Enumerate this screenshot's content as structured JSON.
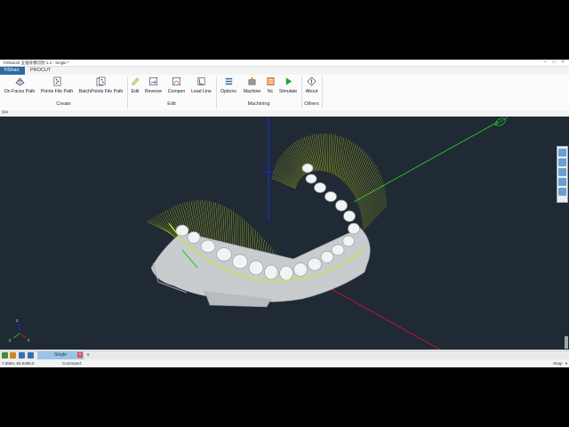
{
  "window": {
    "title": "YiShan32 五轴牙模切割 1.2 - Single *",
    "min_glyph": "–",
    "max_glyph": "□",
    "close_glyph": "×"
  },
  "tabs": [
    {
      "label": "YiShan",
      "active": true
    },
    {
      "label": "PROCUT",
      "active": false
    }
  ],
  "ribbon": {
    "groups": [
      {
        "label": "Create",
        "items": [
          {
            "label": "On Faces Path",
            "icon": "faces-path-icon"
          },
          {
            "label": "Points File Path",
            "icon": "points-file-icon"
          },
          {
            "label": "BatchPoints File Path",
            "icon": "batch-points-icon"
          }
        ]
      },
      {
        "label": "Edit",
        "items": [
          {
            "label": "Edit",
            "icon": "edit-icon"
          },
          {
            "label": "Reverse",
            "icon": "reverse-icon"
          },
          {
            "label": "Compen",
            "icon": "compen-icon"
          },
          {
            "label": "Lead Line",
            "icon": "lead-line-icon"
          }
        ]
      },
      {
        "label": "Machining",
        "items": [
          {
            "label": "Options",
            "icon": "options-icon"
          },
          {
            "label": "Machine",
            "icon": "machine-icon"
          },
          {
            "label": "Nc",
            "icon": "nc-icon"
          },
          {
            "label": "Simulate",
            "icon": "play-icon"
          }
        ]
      },
      {
        "label": "Others",
        "items": [
          {
            "label": "About",
            "icon": "about-icon"
          }
        ]
      }
    ]
  },
  "command_expand": ">>",
  "colors": {
    "accent": "#2d6ca2",
    "viewport_bg": "#1f2a35",
    "toolpath": "#e8f000",
    "axis_x": "#c8102e",
    "axis_y": "#22c32a",
    "axis_z": "#1c2bd0"
  },
  "document_tabs": [
    {
      "label": "Single",
      "active": true
    }
  ],
  "add_tab_glyph": "+",
  "status": {
    "coords": "7.5883,-55.6488,0",
    "command_label": "Command:",
    "snap_label": "Snap",
    "snap_caret": "▾"
  },
  "gizmo": {
    "x_label": "x",
    "y_label": "y",
    "z_label": "z"
  }
}
